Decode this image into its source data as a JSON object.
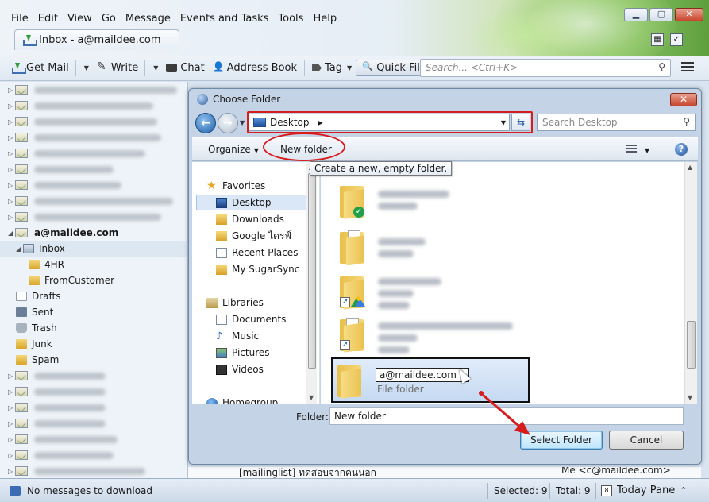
{
  "window": {
    "menu": [
      "File",
      "Edit",
      "View",
      "Go",
      "Message",
      "Events and Tasks",
      "Tools",
      "Help"
    ],
    "controls": {
      "minimize": "▁",
      "maximize": "▢",
      "close": "✕"
    },
    "tab_title": "Inbox - a@maildee.com"
  },
  "toolbar": {
    "get_mail": "Get Mail",
    "write": "Write",
    "chat": "Chat",
    "address_book": "Address Book",
    "tag": "Tag",
    "quick_filter": "Quick Filter",
    "search_placeholder": "Search... <Ctrl+K>"
  },
  "folders": {
    "account": "a@maildee.com",
    "inbox": "Inbox",
    "inbox_children": [
      "4HR",
      "FromCustomer"
    ],
    "system": [
      "Drafts",
      "Sent",
      "Trash",
      "Junk",
      "Spam"
    ]
  },
  "message_list": {
    "subject": "[mailinglist] ทดสอบจากคนนอก",
    "from": "Me <c@maildee.com>"
  },
  "status": {
    "left": "No messages to download",
    "selected": "Selected: 9",
    "total": "Total: 9",
    "today_pane": "Today Pane",
    "today_day": "8"
  },
  "dialog": {
    "title": "Choose Folder",
    "address": "Desktop",
    "search_placeholder": "Search Desktop",
    "organize": "Organize",
    "new_folder": "New folder",
    "tooltip": "Create a new, empty folder.",
    "nav": {
      "favorites": "Favorites",
      "favorite_items": [
        "Desktop",
        "Downloads",
        "Google ไดรฟ์",
        "Recent Places",
        "My SugarSync"
      ],
      "libraries": "Libraries",
      "library_items": [
        "Documents",
        "Music",
        "Pictures",
        "Videos"
      ],
      "homegroup": "Homegroup"
    },
    "selected_item": {
      "name": "a@maildee.com",
      "type": "File folder"
    },
    "folder_label": "Folder:",
    "folder_value": "New folder",
    "select_button": "Select Folder",
    "cancel_button": "Cancel"
  },
  "colors": {
    "annotation_red": "#d71c1c",
    "selection_bg": "#c5d9f2",
    "accent_blue": "#1e5fa8"
  }
}
